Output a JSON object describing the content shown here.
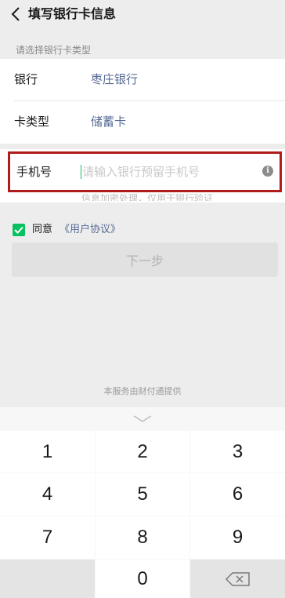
{
  "header": {
    "title": "填写银行卡信息"
  },
  "card_section": {
    "label": "请选择银行卡类型",
    "rows": [
      {
        "key": "银行",
        "value": "枣庄银行"
      },
      {
        "key": "卡类型",
        "value": "储蓄卡"
      }
    ]
  },
  "phone": {
    "label": "手机号",
    "value": "",
    "placeholder": "请输入银行预留手机号",
    "info_icon": "i",
    "notice": "信息加密处理，仅用于银行验证"
  },
  "agreement": {
    "checked": true,
    "text": "同意",
    "link": "《用户协议》"
  },
  "next_button": {
    "label": "下一步"
  },
  "service_text": "本服务由财付通提供",
  "keypad": {
    "keys": [
      "1",
      "2",
      "3",
      "4",
      "5",
      "6",
      "7",
      "8",
      "9",
      "0"
    ]
  },
  "colors": {
    "accent": "#07c160",
    "link": "#576b95",
    "highlight_border": "#b01b1b"
  }
}
